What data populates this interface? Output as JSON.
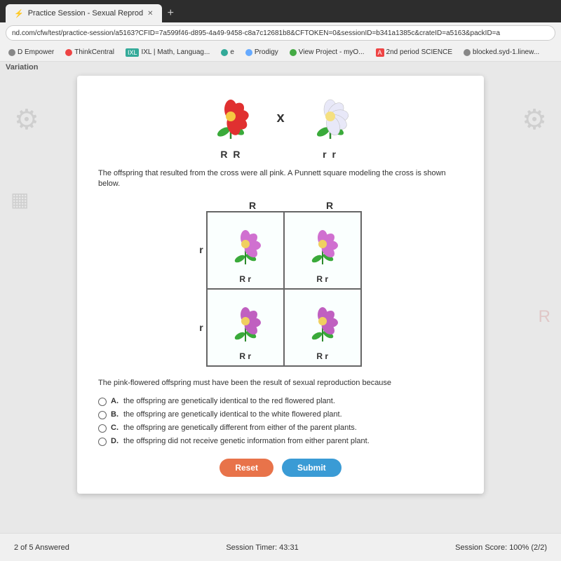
{
  "browser": {
    "tab_title": "Practice Session - Sexual Reprod",
    "tab_icon": "⚡",
    "address": "nd.com/cfw/test/practice-session/a5163?CFID=7a599f46-d895-4a49-9458-c8a7c12681b8&CFTOKEN=0&sessionID=b341a1385c&crateID=a5163&packID=a",
    "new_tab": "+",
    "bookmarks": [
      {
        "label": "D Empower",
        "color": "#888"
      },
      {
        "label": "ThinkCentral",
        "color": "#e44"
      },
      {
        "label": "IXL | Math, Languag...",
        "color": "#3a9"
      },
      {
        "label": "e",
        "color": "#3a9"
      },
      {
        "label": "Prodigy",
        "color": "#6af"
      },
      {
        "label": "View Project - myO...",
        "color": "#4a4"
      },
      {
        "label": "2nd period SCIENCE",
        "color": "#e44"
      },
      {
        "label": "blocked.syd-1.linew...",
        "color": "#888"
      }
    ]
  },
  "page_label": "Variation",
  "content": {
    "parent_labels": {
      "red_label": "R R",
      "white_label": "r r",
      "cross_symbol": "x"
    },
    "description": "The offspring that resulted from the cross were all pink. A Punnett square modeling the cross is shown below.",
    "punnett": {
      "col_headers": [
        "R",
        "R"
      ],
      "row_headers": [
        "r",
        "r"
      ],
      "cells": [
        {
          "label": "R r"
        },
        {
          "label": "R r"
        },
        {
          "label": "R r"
        },
        {
          "label": "R r"
        }
      ]
    },
    "question": "The pink-flowered offspring must have been the result of sexual reproduction because",
    "options": [
      {
        "letter": "A.",
        "text": "the offspring are genetically identical to the red flowered plant."
      },
      {
        "letter": "B.",
        "text": "the offspring are genetically identical to the white flowered plant."
      },
      {
        "letter": "C.",
        "text": "the offspring are genetically different from either of the parent plants."
      },
      {
        "letter": "D.",
        "text": "the offspring did not receive genetic information from either parent plant."
      }
    ],
    "buttons": {
      "reset": "Reset",
      "submit": "Submit"
    }
  },
  "status_bar": {
    "answered": "2 of 5 Answered",
    "timer_label": "Session Timer:",
    "timer_value": "43:31",
    "score_label": "Session Score:",
    "score_value": "100% (2/2)"
  }
}
